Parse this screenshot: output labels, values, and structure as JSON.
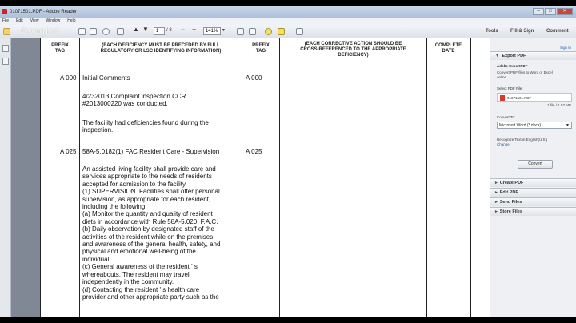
{
  "window": {
    "title": "01071501.PDF - Adobe Reader",
    "controls": [
      "–",
      "□",
      "✕"
    ]
  },
  "menu": [
    "File",
    "Edit",
    "View",
    "Window",
    "Help"
  ],
  "toolbar": {
    "page_current": "1",
    "page_total": "/ 8",
    "zoom": "141%",
    "watermark": "Google+",
    "tools_label": "Tools",
    "fill_sign_label": "Fill & Sign",
    "comment_label": "Comment"
  },
  "document": {
    "headers": {
      "prefix_tag_1": "PREFIX\nTAG",
      "deficiency": "(EACH DEFICIENCY MUST BE PRECEDED BY FULL\nREGULATORY OR LSC IDENTIFYING INFORMATION)",
      "prefix_tag_2": "PREFIX\nTAG",
      "corrective": "(EACH CORRECTIVE ACTION SHOULD BE\nCROSS-REFERENCED TO THE APPROPRIATE\nDEFICIENCY)",
      "complete_date": "COMPLETE\nDATE"
    },
    "rows": [
      {
        "tag_left": "A 000",
        "tag_right": "A 000",
        "title": "Initial Comments",
        "paragraphs": [
          "4/232013 Complaint inspection CCR\n#2013000220 was conducted.",
          "The facility had deficiencies found during the\ninspection."
        ]
      },
      {
        "tag_left": "A 025",
        "tag_right": "A 025",
        "title": "58A-5.0182(1) FAC Resident Care - Supervision",
        "paragraphs": [
          "An assisted living facility shall provide care and\nservices appropriate to the needs of residents\naccepted for admission to the facility.\n(1) SUPERVISION. Facilities shall offer personal\nsupervision, as appropriate for each resident,\nincluding the following:\n(a) Monitor the quantity and quality of resident\ndiets in accordance with Rule 58A-5.020, F.A.C.\n(b) Daily observation by designated staff of the\nactivities of the resident while on the premises,\nand awareness of the general health, safety, and\nphysical and emotional well-being of the\nindividual.\n(c) General awareness of the resident ' s\nwhereabouts. The resident may travel\nindependently in the community.\n(d) Contacting the resident ' s health care\nprovider and other appropriate party such as the"
        ]
      }
    ]
  },
  "right_panel": {
    "sign_in": "Sign In",
    "export_header": "Export PDF",
    "service_name": "Adobe ExportPDF",
    "description": "Convert PDF files to Word or Excel\nonline.",
    "select_file_label": "Select PDF File:",
    "file_name": "01071501.PDF",
    "file_meta": "1 file / 1.57 MB",
    "convert_to_label": "Convert To:",
    "convert_to_value": "Microsoft Word (*.docx)",
    "recognize_text": "Recognize Text in English(U.S.)",
    "change_link": "Change",
    "convert_button": "Convert",
    "sections": [
      "Create PDF",
      "Edit PDF",
      "Send Files",
      "Store Files"
    ]
  }
}
